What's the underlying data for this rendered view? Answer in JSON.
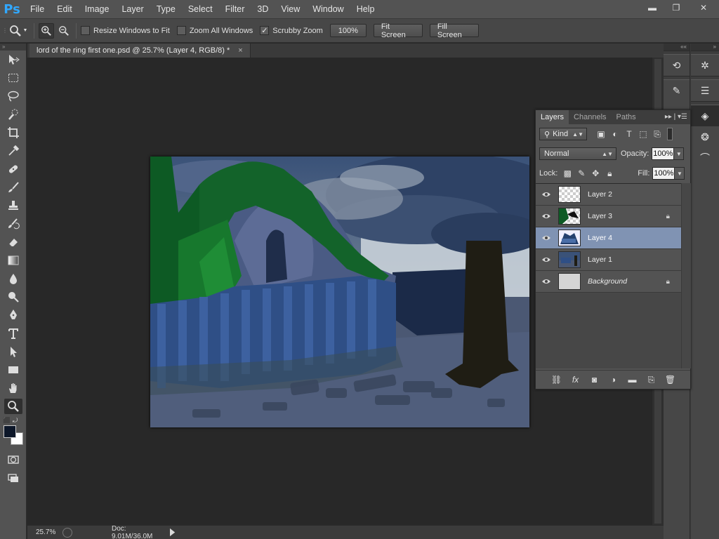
{
  "app": {
    "logo": "Ps"
  },
  "menu": [
    "File",
    "Edit",
    "Image",
    "Layer",
    "Type",
    "Select",
    "Filter",
    "3D",
    "View",
    "Window",
    "Help"
  ],
  "window_controls": {
    "minimize": "▬",
    "restore": "❐",
    "close": "✕"
  },
  "options": {
    "resize_windows": "Resize Windows to Fit",
    "resize_checked": false,
    "zoom_all": "Zoom All Windows",
    "zoom_all_checked": false,
    "scrubby": "Scrubby Zoom",
    "scrubby_checked": true,
    "btn_100": "100%",
    "btn_fit": "Fit Screen",
    "btn_fill": "Fill Screen"
  },
  "document": {
    "tab_title": "lord of the ring first one.psd @ 25.7% (Layer 4, RGB/8) *",
    "close": "×"
  },
  "status": {
    "zoom": "25.7%",
    "doc": "Doc: 9.01M/36.0M"
  },
  "colors": {
    "foreground": "#0d1729",
    "background": "#ffffff",
    "selection": "#8093b3"
  },
  "layers_panel": {
    "tabs": [
      "Layers",
      "Channels",
      "Paths"
    ],
    "kind": "Kind",
    "blend_mode": "Normal",
    "opacity_label": "Opacity:",
    "opacity": "100%",
    "lock_label": "Lock:",
    "fill_label": "Fill:",
    "fill": "100%",
    "layers": [
      {
        "name": "Layer 2",
        "thumb": "transparent",
        "locked": false,
        "selected": false,
        "visible": true
      },
      {
        "name": "Layer 3",
        "thumb": "trees",
        "locked": true,
        "selected": false,
        "visible": true
      },
      {
        "name": "Layer 4",
        "thumb": "painting",
        "locked": false,
        "selected": true,
        "visible": true
      },
      {
        "name": "Layer 1",
        "thumb": "scene",
        "locked": false,
        "selected": false,
        "visible": true
      },
      {
        "name": "Background",
        "thumb": "white",
        "locked": true,
        "selected": false,
        "visible": true
      }
    ]
  }
}
